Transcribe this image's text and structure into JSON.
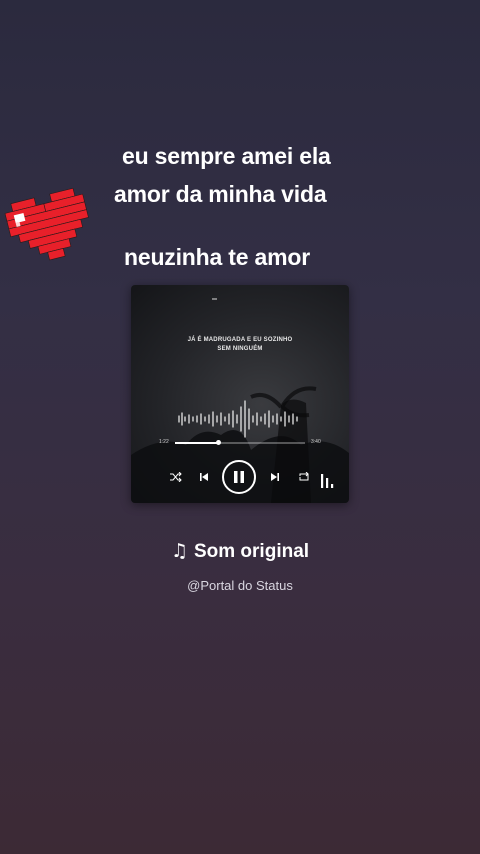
{
  "captions": {
    "line1": "eu sempre amei ela",
    "line2": "amor da minha vida",
    "line3": "neuzinha te amor"
  },
  "sticker": {
    "icon": "pixel-heart-icon",
    "color": "#e8202a"
  },
  "player_card": {
    "lyrics_line1": "JÁ É MADRUGADA E EU SOZINHO",
    "lyrics_line2": "SEM NINGUÉM",
    "time_elapsed": "1:22",
    "time_total": "3:40",
    "progress": 0.33,
    "controls": {
      "shuffle": "shuffle-icon",
      "previous": "skip-previous-icon",
      "pause": "pause-icon",
      "next": "skip-next-icon",
      "repeat": "repeat-icon",
      "equalizer": "equalizer-bars-icon"
    }
  },
  "audio": {
    "note_icon": "♫",
    "title": "Som original",
    "author": "@Portal do Status"
  }
}
